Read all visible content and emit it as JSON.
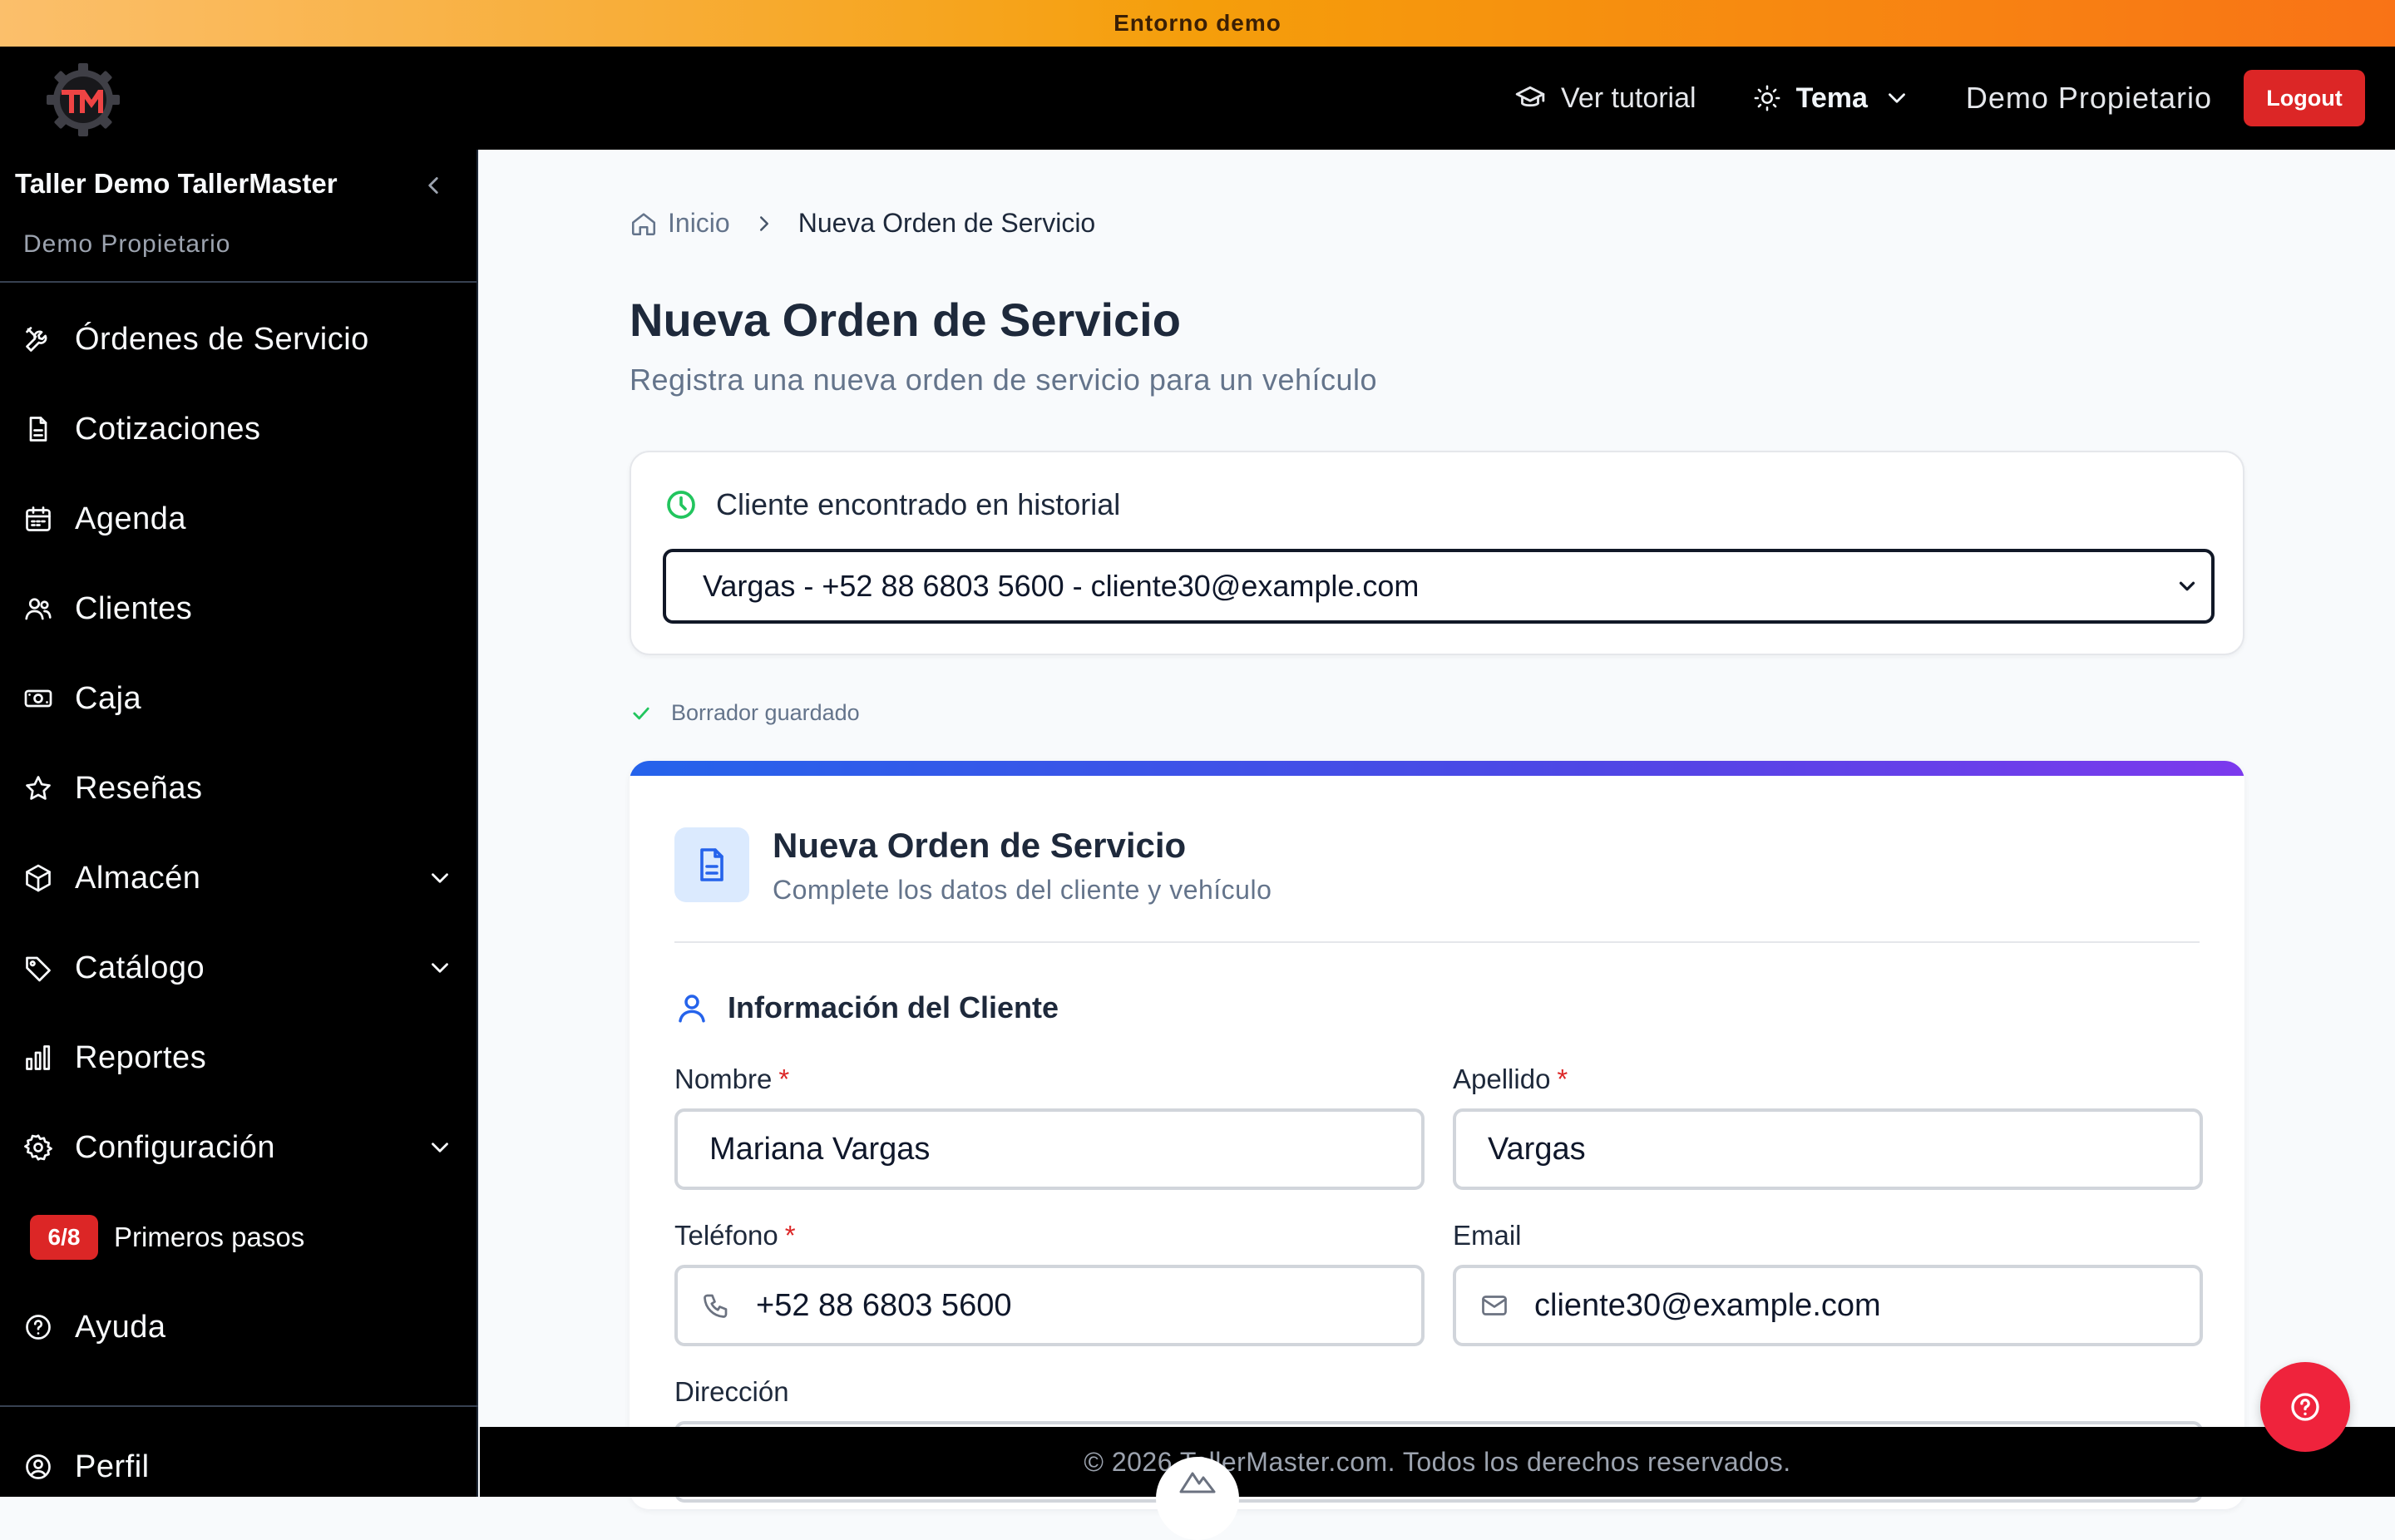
{
  "banner": {
    "text": "Entorno demo"
  },
  "header": {
    "tutorial_label": "Ver tutorial",
    "theme_label": "Tema",
    "user_name": "Demo Propietario",
    "logout_label": "Logout"
  },
  "sidebar": {
    "shop_name": "Taller Demo TallerMaster",
    "user_name": "Demo Propietario",
    "items": [
      {
        "label": "Órdenes de Servicio",
        "icon": "tools-icon"
      },
      {
        "label": "Cotizaciones",
        "icon": "document-icon"
      },
      {
        "label": "Agenda",
        "icon": "calendar-icon"
      },
      {
        "label": "Clientes",
        "icon": "users-icon"
      },
      {
        "label": "Caja",
        "icon": "cash-icon"
      },
      {
        "label": "Reseñas",
        "icon": "star-icon"
      },
      {
        "label": "Almacén",
        "icon": "box-icon"
      },
      {
        "label": "Catálogo",
        "icon": "tag-icon"
      },
      {
        "label": "Reportes",
        "icon": "bar-chart-icon"
      },
      {
        "label": "Configuración",
        "icon": "gear-icon"
      }
    ],
    "onboarding": {
      "badge": "6/8",
      "label": "Primeros pasos"
    },
    "help_label": "Ayuda",
    "profile_label": "Perfil"
  },
  "breadcrumb": {
    "home": "Inicio",
    "current": "Nueva Orden de Servicio"
  },
  "page": {
    "title": "Nueva Orden de Servicio",
    "subtitle": "Registra una nueva orden de servicio para un vehículo"
  },
  "history": {
    "title": "Cliente encontrado en historial",
    "selected": "Vargas - +52 88 6803 5600 - cliente30@example.com"
  },
  "draft_status": "Borrador guardado",
  "form": {
    "title": "Nueva Orden de Servicio",
    "subtitle": "Complete los datos del cliente y vehículo",
    "section_title": "Información del Cliente",
    "fields": {
      "nombre": {
        "label": "Nombre",
        "required": "*",
        "value": "Mariana Vargas"
      },
      "apellido": {
        "label": "Apellido",
        "required": "*",
        "value": "Vargas"
      },
      "telefono": {
        "label": "Teléfono",
        "required": "*",
        "value": "+52 88 6803 5600"
      },
      "email": {
        "label": "Email",
        "value": "cliente30@example.com"
      },
      "direccion": {
        "label": "Dirección"
      }
    }
  },
  "footer": {
    "text": "© 2026 TallerMaster.com. Todos los derechos reservados."
  },
  "colors": {
    "accent_red": "#dc2626",
    "banner_orange": "#f59e0b",
    "primary_blue": "#2563eb",
    "success_green": "#22c55e"
  }
}
